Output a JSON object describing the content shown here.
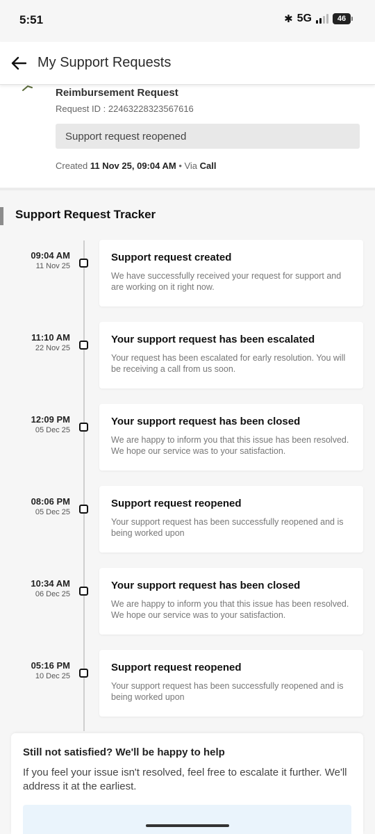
{
  "status_bar": {
    "time": "5:51",
    "bluetooth_icon": "bluetooth-icon",
    "network": "5G",
    "signal_icon": "signal-bars-icon",
    "battery": "46"
  },
  "header": {
    "back_icon": "arrow-left-icon",
    "title": "My Support Requests"
  },
  "request": {
    "name": "Reimbursement Request",
    "id_text": "Request ID : 22463228323567616",
    "status": "Support request reopened",
    "created_label": "Created",
    "created_value": "11 Nov 25, 09:04 AM",
    "via_label": "• Via",
    "via_value": "Call"
  },
  "tracker": {
    "title": "Support Request Tracker",
    "events": [
      {
        "time": "09:04 AM",
        "date": "11 Nov 25",
        "title": "Support request created",
        "desc": "We have successfully received your request for support and are working on it right now."
      },
      {
        "time": "11:10 AM",
        "date": "22 Nov 25",
        "title": "Your support request has been escalated",
        "desc": "Your request has been escalated for early resolution. You will be receiving a call from us soon."
      },
      {
        "time": "12:09 PM",
        "date": "05 Dec 25",
        "title": "Your support request has been closed",
        "desc": "We are happy to inform you that this issue has been resolved. We hope our service was to your satisfaction."
      },
      {
        "time": "08:06 PM",
        "date": "05 Dec 25",
        "title": "Support request reopened",
        "desc": "Your support request has been successfully reopened and is being worked upon"
      },
      {
        "time": "10:34 AM",
        "date": "06 Dec 25",
        "title": "Your support request has been closed",
        "desc": "We are happy to inform you that this issue has been resolved. We hope our service was to your satisfaction."
      },
      {
        "time": "05:16 PM",
        "date": "10 Dec 25",
        "title": "Support request reopened",
        "desc": "Your support request has been successfully reopened and is being worked upon"
      }
    ]
  },
  "help": {
    "title": "Still not satisfied? We'll be happy to help",
    "text": "If you feel your issue isn't resolved, feel free to escalate it further. We'll address it at the earliest."
  },
  "colors": {
    "status_pill_bg": "#e8e8e8",
    "tracker_bg": "#f6f6f6",
    "help_action_bg": "#eaf4fc"
  }
}
